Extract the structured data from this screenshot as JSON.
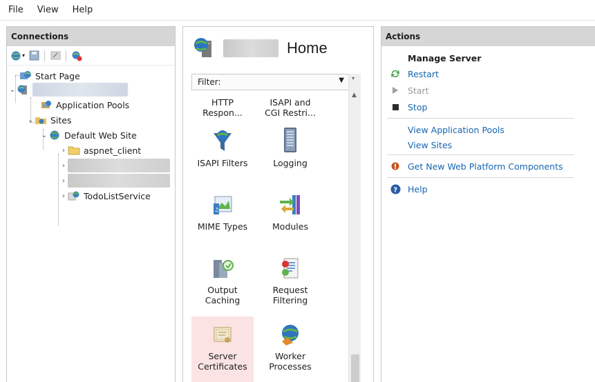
{
  "menu": {
    "file": "File",
    "view": "View",
    "help": "Help"
  },
  "connections": {
    "header": "Connections",
    "tree": {
      "start_page": "Start Page",
      "application_pools": "Application Pools",
      "sites": "Sites",
      "default_web_site": "Default Web Site",
      "aspnet_client": "aspnet_client",
      "todolist_service": "TodoListService"
    }
  },
  "home": {
    "title": "Home",
    "filter_label": "Filter:",
    "features": [
      {
        "line1": "HTTP",
        "line2": "Respon..."
      },
      {
        "line1": "ISAPI and",
        "line2": "CGI Restri..."
      },
      {
        "line1": "ISAPI Filters",
        "line2": ""
      },
      {
        "line1": "Logging",
        "line2": ""
      },
      {
        "line1": "MIME Types",
        "line2": ""
      },
      {
        "line1": "Modules",
        "line2": ""
      },
      {
        "line1": "Output",
        "line2": "Caching"
      },
      {
        "line1": "Request",
        "line2": "Filtering"
      },
      {
        "line1": "Server",
        "line2": "Certificates"
      },
      {
        "line1": "Worker",
        "line2": "Processes"
      }
    ]
  },
  "actions": {
    "header": "Actions",
    "manage_server": "Manage Server",
    "restart": "Restart",
    "start": "Start",
    "stop": "Stop",
    "view_app_pools": "View Application Pools",
    "view_sites": "View Sites",
    "get_new_components": "Get New Web Platform Components",
    "help": "Help"
  },
  "colors": {
    "link": "#1665b0",
    "header_bg": "#d6d6d6",
    "selected_bg": "#fbe3e3"
  },
  "icons": [
    "globe-icon",
    "save-icon",
    "refresh-icon",
    "connect-icon",
    "server-icon",
    "folder-icon",
    "world-icon"
  ]
}
